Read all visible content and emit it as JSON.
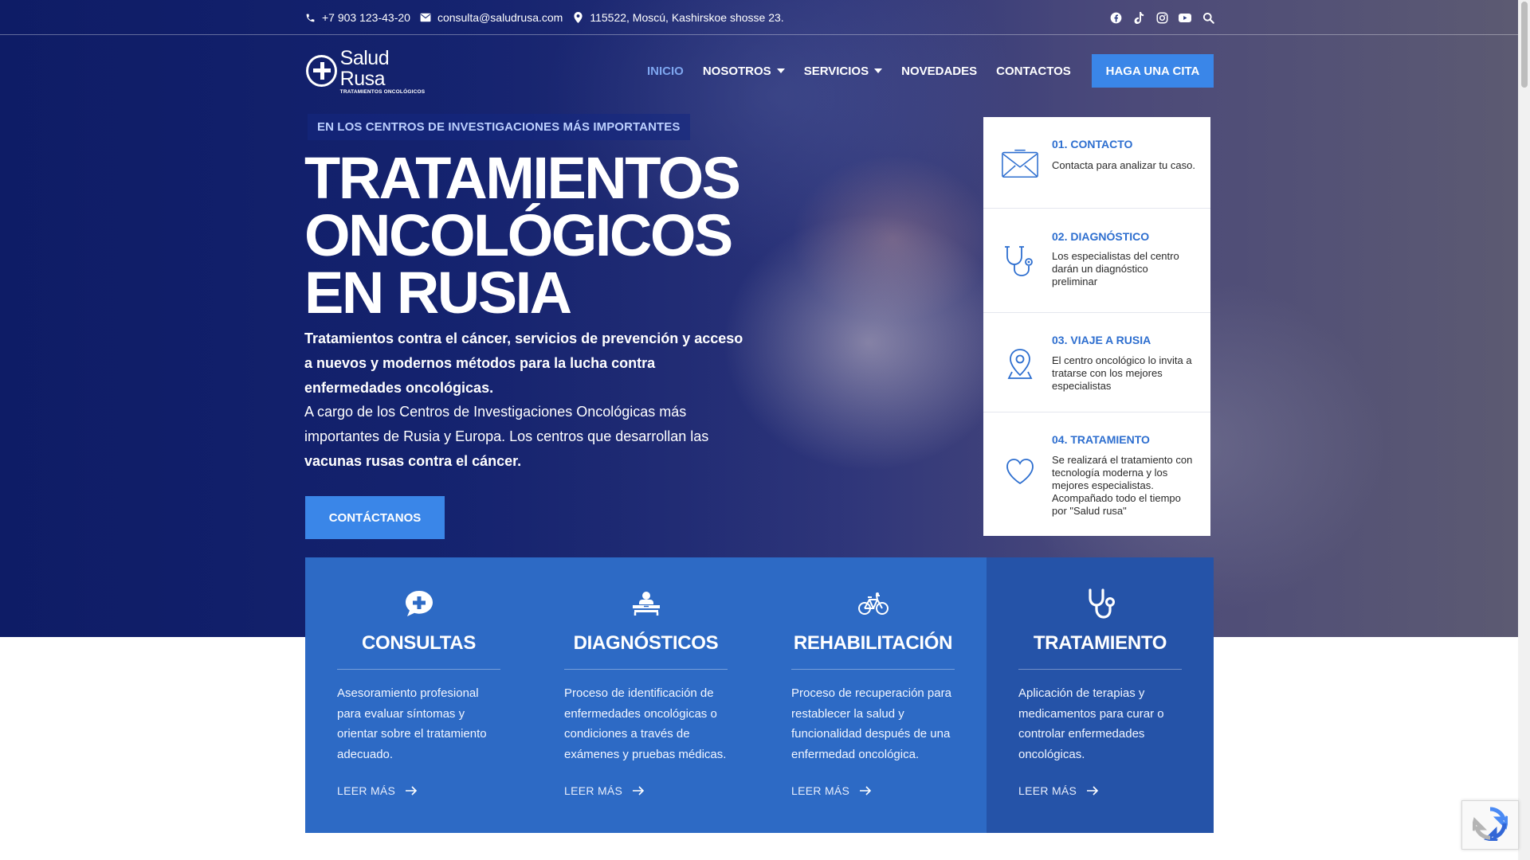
{
  "topbar": {
    "phone": "+7 903 123-43-20",
    "email": "consulta@saludrusa.com",
    "address": "115522, Moscú, Kashirskoe shosse 23.",
    "social_icons": [
      "facebook-icon",
      "tiktok-icon",
      "instagram-icon",
      "youtube-icon",
      "search-icon"
    ]
  },
  "logo": {
    "name": "Salud Rusa",
    "tagline": "TRATAMIENTOS ONCOLÓGICOS"
  },
  "nav": {
    "items": [
      {
        "label": "INICIO",
        "active": true
      },
      {
        "label": "NOSOTROS",
        "dropdown": true
      },
      {
        "label": "SERVICIOS",
        "dropdown": true
      },
      {
        "label": "NOVEDADES"
      },
      {
        "label": "CONTACTOS"
      }
    ],
    "cta": "HAGA UNA CITA"
  },
  "hero": {
    "kicker": "EN LOS CENTROS DE INVESTIGACIONES MÁS IMPORTANTES",
    "title_lines": [
      "TRATAMIENTOS",
      "ONCOLÓGICOS",
      "EN RUSIA"
    ],
    "lead": "Tratamientos contra el cáncer, servicios de prevención y acceso a nuevos y modernos métodos para la lucha contra enfermedades oncológicas.",
    "body": "A cargo de los Centros de Investigaciones Oncológicas más importantes de Rusia y Europa. Los centros que desarrollan las",
    "body_bold": "vacunas rusas contra el cáncer.",
    "button": "CONTÁCTANOS"
  },
  "steps": [
    {
      "title": "01. CONTACTO",
      "desc": "Contacta para analizar tu caso.",
      "icon": "envelope-icon"
    },
    {
      "title": "02. DIAGNÓSTICO",
      "desc": "Los especialistas del centro darán un diagnóstico preliminar",
      "icon": "stethoscope-icon"
    },
    {
      "title": "03. VIAJE A RUSIA",
      "desc": "El centro oncológico lo invita a tratarse con los mejores especialistas",
      "icon": "map-pin-icon"
    },
    {
      "title": "04. TRATAMIENTO",
      "desc": "Se realizará el tratamiento con tecnología moderna y los mejores especialistas. Acompañado todo el tiempo por \"Salud rusa\"",
      "icon": "heart-icon"
    }
  ],
  "services": [
    {
      "title": "CONSULTAS",
      "desc": "Asesoramiento profesional para evaluar síntomas y orientar sobre el tratamiento adecuado.",
      "more": "LEER MÁS",
      "icon": "chat-medical-icon"
    },
    {
      "title": "DIAGNÓSTICOS",
      "desc": "Proceso de identificación de enfermedades oncológicas o condiciones a través de exámenes y pruebas médicas.",
      "more": "LEER MÁS",
      "icon": "patient-bed-icon"
    },
    {
      "title": "REHABILITACIÓN",
      "desc": "Proceso de recuperación para restablecer la salud y funcionalidad después de una enfermedad oncológica.",
      "more": "LEER MÁS",
      "icon": "bicycle-icon"
    },
    {
      "title": "TRATAMIENTO",
      "desc": "Aplicación de terapias y medicamentos para curar o controlar enfermedades oncológicas.",
      "more": "LEER MÁS",
      "icon": "stethoscope-icon"
    }
  ],
  "colors": {
    "accent": "#3a86e8",
    "services_bg": "#2d6ac5",
    "services_alt_bg": "#2553a8",
    "step_title": "#2d6ecf",
    "nav_active": "#7ea6ef"
  }
}
